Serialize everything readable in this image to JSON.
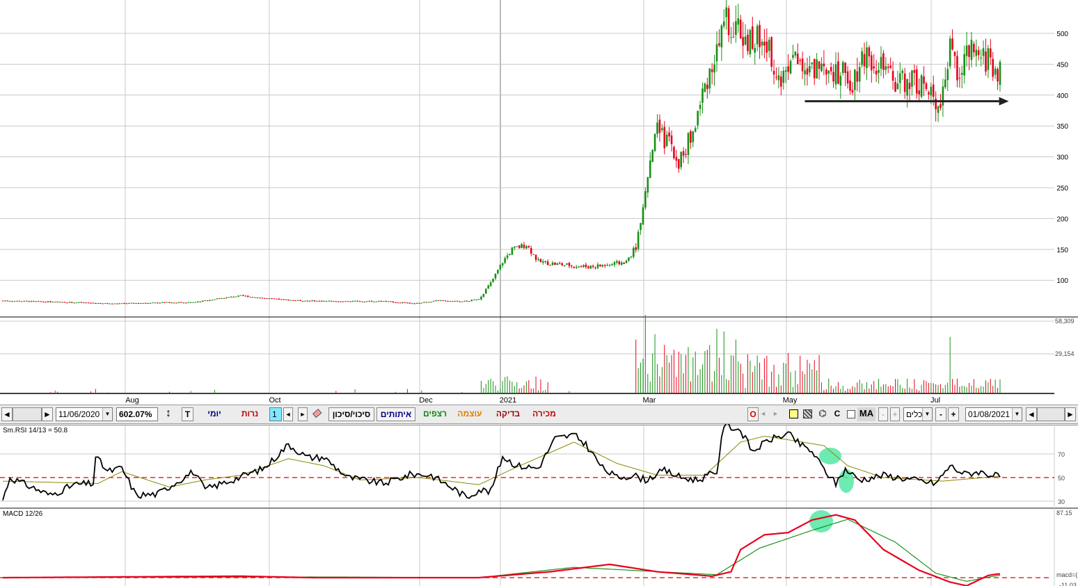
{
  "chart_data": {
    "type": "candlestick",
    "price_axis": {
      "ticks": [
        100,
        150,
        200,
        250,
        300,
        350,
        400,
        450,
        500
      ],
      "range": [
        58,
        560
      ]
    },
    "volume_axis": {
      "ticks": [
        "29,154",
        "58,309"
      ]
    },
    "x_labels": [
      "Aug",
      "Oct",
      "Dec",
      "2021",
      "Mar",
      "May",
      "Jul"
    ],
    "price_anchors": [
      {
        "i": 0,
        "v": 67
      },
      {
        "i": 30,
        "v": 64
      },
      {
        "i": 40,
        "v": 63
      },
      {
        "i": 45,
        "v": 62
      },
      {
        "i": 57,
        "v": 63
      },
      {
        "i": 65,
        "v": 64
      },
      {
        "i": 80,
        "v": 64
      },
      {
        "i": 90,
        "v": 70
      },
      {
        "i": 100,
        "v": 75
      },
      {
        "i": 112,
        "v": 70
      },
      {
        "i": 125,
        "v": 67
      },
      {
        "i": 140,
        "v": 66
      },
      {
        "i": 160,
        "v": 66
      },
      {
        "i": 173,
        "v": 62
      },
      {
        "i": 182,
        "v": 67
      },
      {
        "i": 195,
        "v": 66
      },
      {
        "i": 200,
        "v": 70
      },
      {
        "i": 205,
        "v": 95
      },
      {
        "i": 210,
        "v": 130
      },
      {
        "i": 214,
        "v": 150
      },
      {
        "i": 220,
        "v": 158
      },
      {
        "i": 225,
        "v": 130
      },
      {
        "i": 233,
        "v": 126
      },
      {
        "i": 245,
        "v": 122
      },
      {
        "i": 255,
        "v": 125
      },
      {
        "i": 262,
        "v": 130
      },
      {
        "i": 266,
        "v": 155
      },
      {
        "i": 270,
        "v": 250
      },
      {
        "i": 275,
        "v": 340
      },
      {
        "i": 280,
        "v": 320
      },
      {
        "i": 284,
        "v": 290
      },
      {
        "i": 290,
        "v": 340
      },
      {
        "i": 296,
        "v": 430
      },
      {
        "i": 300,
        "v": 470
      },
      {
        "i": 304,
        "v": 520
      },
      {
        "i": 309,
        "v": 510
      },
      {
        "i": 313,
        "v": 480
      },
      {
        "i": 318,
        "v": 500
      },
      {
        "i": 323,
        "v": 460
      },
      {
        "i": 327,
        "v": 420
      },
      {
        "i": 332,
        "v": 480
      },
      {
        "i": 338,
        "v": 430
      },
      {
        "i": 345,
        "v": 460
      },
      {
        "i": 350,
        "v": 440
      },
      {
        "i": 357,
        "v": 425
      },
      {
        "i": 362,
        "v": 470
      },
      {
        "i": 368,
        "v": 450
      },
      {
        "i": 374,
        "v": 420
      },
      {
        "i": 380,
        "v": 425
      },
      {
        "i": 386,
        "v": 420
      },
      {
        "i": 390,
        "v": 395
      },
      {
        "i": 394,
        "v": 395
      },
      {
        "i": 398,
        "v": 470
      },
      {
        "i": 402,
        "v": 435
      },
      {
        "i": 406,
        "v": 470
      },
      {
        "i": 410,
        "v": 455
      },
      {
        "i": 414,
        "v": 460
      },
      {
        "i": 418,
        "v": 438
      }
    ],
    "volume_spikes": [
      {
        "i": 270,
        "v": 58309
      },
      {
        "i": 266,
        "v": 40000
      },
      {
        "i": 274,
        "v": 44000
      },
      {
        "i": 278,
        "v": 36000
      },
      {
        "i": 284,
        "v": 31000
      },
      {
        "i": 300,
        "v": 48000
      },
      {
        "i": 303,
        "v": 46000
      },
      {
        "i": 308,
        "v": 40000
      },
      {
        "i": 313,
        "v": 29000
      },
      {
        "i": 320,
        "v": 26000
      },
      {
        "i": 330,
        "v": 30000
      },
      {
        "i": 335,
        "v": 28000
      },
      {
        "i": 338,
        "v": 25000
      },
      {
        "i": 398,
        "v": 42000
      }
    ],
    "support_line": {
      "from_i": 337,
      "to_i": 418,
      "v": 390
    },
    "rsi": {
      "label": "Sm.RSI 14/13 = 50.8",
      "ticks": [
        30,
        50,
        70
      ],
      "reference": 50,
      "anchors": [
        {
          "i": 0,
          "v": 31
        },
        {
          "i": 3,
          "v": 50
        },
        {
          "i": 12,
          "v": 42
        },
        {
          "i": 20,
          "v": 35
        },
        {
          "i": 30,
          "v": 44
        },
        {
          "i": 38,
          "v": 45
        },
        {
          "i": 39,
          "v": 68
        },
        {
          "i": 44,
          "v": 55
        },
        {
          "i": 50,
          "v": 58
        },
        {
          "i": 56,
          "v": 35
        },
        {
          "i": 65,
          "v": 36
        },
        {
          "i": 72,
          "v": 45
        },
        {
          "i": 80,
          "v": 55
        },
        {
          "i": 85,
          "v": 40
        },
        {
          "i": 95,
          "v": 47
        },
        {
          "i": 110,
          "v": 58
        },
        {
          "i": 120,
          "v": 78
        },
        {
          "i": 128,
          "v": 67
        },
        {
          "i": 135,
          "v": 67
        },
        {
          "i": 145,
          "v": 50
        },
        {
          "i": 160,
          "v": 45
        },
        {
          "i": 172,
          "v": 53
        },
        {
          "i": 180,
          "v": 52
        },
        {
          "i": 190,
          "v": 40
        },
        {
          "i": 195,
          "v": 33
        },
        {
          "i": 200,
          "v": 40
        },
        {
          "i": 205,
          "v": 38
        },
        {
          "i": 210,
          "v": 68
        },
        {
          "i": 216,
          "v": 60
        },
        {
          "i": 225,
          "v": 58
        },
        {
          "i": 232,
          "v": 83
        },
        {
          "i": 240,
          "v": 86
        },
        {
          "i": 245,
          "v": 78
        },
        {
          "i": 252,
          "v": 58
        },
        {
          "i": 258,
          "v": 50
        },
        {
          "i": 265,
          "v": 52
        },
        {
          "i": 270,
          "v": 48
        },
        {
          "i": 278,
          "v": 56
        },
        {
          "i": 285,
          "v": 50
        },
        {
          "i": 292,
          "v": 48
        },
        {
          "i": 300,
          "v": 55
        },
        {
          "i": 303,
          "v": 95
        },
        {
          "i": 310,
          "v": 90
        },
        {
          "i": 315,
          "v": 72
        },
        {
          "i": 322,
          "v": 82
        },
        {
          "i": 330,
          "v": 87
        },
        {
          "i": 335,
          "v": 78
        },
        {
          "i": 340,
          "v": 72
        },
        {
          "i": 345,
          "v": 57
        },
        {
          "i": 350,
          "v": 45
        },
        {
          "i": 354,
          "v": 57
        },
        {
          "i": 360,
          "v": 48
        },
        {
          "i": 370,
          "v": 52
        },
        {
          "i": 380,
          "v": 49
        },
        {
          "i": 392,
          "v": 45
        },
        {
          "i": 398,
          "v": 60
        },
        {
          "i": 404,
          "v": 53
        },
        {
          "i": 410,
          "v": 55
        },
        {
          "i": 418,
          "v": 51
        }
      ],
      "signal_anchors": [
        {
          "i": 0,
          "v": 47
        },
        {
          "i": 40,
          "v": 45
        },
        {
          "i": 50,
          "v": 55
        },
        {
          "i": 70,
          "v": 42
        },
        {
          "i": 85,
          "v": 48
        },
        {
          "i": 100,
          "v": 52
        },
        {
          "i": 120,
          "v": 66
        },
        {
          "i": 135,
          "v": 60
        },
        {
          "i": 150,
          "v": 48
        },
        {
          "i": 175,
          "v": 50
        },
        {
          "i": 200,
          "v": 44
        },
        {
          "i": 215,
          "v": 58
        },
        {
          "i": 240,
          "v": 80
        },
        {
          "i": 258,
          "v": 62
        },
        {
          "i": 275,
          "v": 52
        },
        {
          "i": 295,
          "v": 52
        },
        {
          "i": 310,
          "v": 80
        },
        {
          "i": 320,
          "v": 85
        },
        {
          "i": 330,
          "v": 82
        },
        {
          "i": 345,
          "v": 77
        },
        {
          "i": 355,
          "v": 60
        },
        {
          "i": 370,
          "v": 50
        },
        {
          "i": 395,
          "v": 47
        },
        {
          "i": 418,
          "v": 51
        }
      ]
    },
    "macd": {
      "label": "MACD 12/26",
      "ticks": [
        "87.15",
        "-11.03"
      ],
      "range": [
        -11.03,
        87.15
      ],
      "zero_label": "macd=(",
      "anchors": [
        {
          "i": 0,
          "v": 0
        },
        {
          "i": 50,
          "v": 1
        },
        {
          "i": 100,
          "v": 2
        },
        {
          "i": 130,
          "v": 0
        },
        {
          "i": 200,
          "v": 0
        },
        {
          "i": 230,
          "v": 8
        },
        {
          "i": 255,
          "v": 18
        },
        {
          "i": 275,
          "v": 8
        },
        {
          "i": 298,
          "v": 2
        },
        {
          "i": 306,
          "v": 8
        },
        {
          "i": 310,
          "v": 38
        },
        {
          "i": 320,
          "v": 58
        },
        {
          "i": 330,
          "v": 61
        },
        {
          "i": 340,
          "v": 78
        },
        {
          "i": 350,
          "v": 85
        },
        {
          "i": 358,
          "v": 78
        },
        {
          "i": 370,
          "v": 38
        },
        {
          "i": 385,
          "v": 10
        },
        {
          "i": 398,
          "v": -6
        },
        {
          "i": 405,
          "v": -11
        },
        {
          "i": 414,
          "v": 3
        },
        {
          "i": 418,
          "v": 5
        }
      ],
      "signal_anchors": [
        {
          "i": 0,
          "v": 0
        },
        {
          "i": 130,
          "v": 1
        },
        {
          "i": 200,
          "v": 0
        },
        {
          "i": 240,
          "v": 14
        },
        {
          "i": 300,
          "v": 4
        },
        {
          "i": 318,
          "v": 40
        },
        {
          "i": 340,
          "v": 64
        },
        {
          "i": 355,
          "v": 79
        },
        {
          "i": 375,
          "v": 48
        },
        {
          "i": 392,
          "v": 6
        },
        {
          "i": 405,
          "v": -5
        },
        {
          "i": 418,
          "v": 3
        }
      ]
    },
    "highlights": [
      "rsi-1",
      "rsi-2",
      "macd-cross"
    ],
    "colors": {
      "up": "#169016",
      "down": "#e8001c",
      "rsi": "#000000",
      "rsi_signal": "#8a8a00",
      "macd": "#e8001c",
      "macd_signal": "#0a8a0a",
      "ref": "#e00000",
      "highlight": "#55e8a4",
      "grid": "#c8c8c8"
    }
  },
  "toolbar": {
    "start_date": "11/06/2020",
    "percent": "602.07%",
    "t_label": "T",
    "daily": "יומי",
    "candles": "נרות",
    "step": "1",
    "risk": "סיכוי/סיכון",
    "signals": "איתותים",
    "rezefim": "רצפים",
    "strength": "עוצמה",
    "check": "בדיקה",
    "sale": "מכירה",
    "o_label": "O",
    "c_label": "C",
    "ma_label": "MA",
    "tools": "כלים",
    "minus": "-",
    "plus": "+",
    "end_date": "01/08/2021",
    "left_arrow": "◄",
    "right_arrow": "►"
  }
}
